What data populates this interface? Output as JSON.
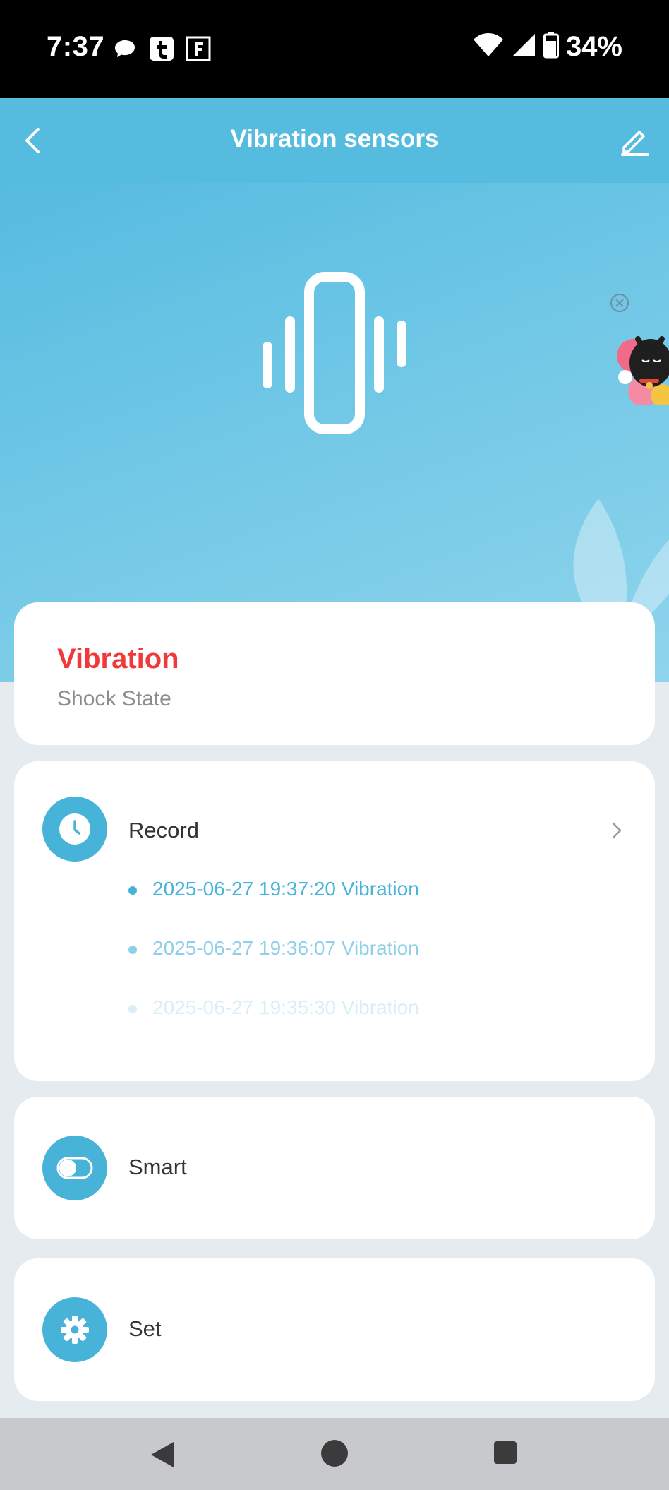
{
  "status_bar": {
    "time": "7:37",
    "battery_text": "34%",
    "left_icons": [
      "chat-bubble-icon",
      "t-app-icon",
      "f-app-icon"
    ],
    "right_icons": [
      "wifi-icon",
      "cell-signal-icon",
      "battery-icon"
    ]
  },
  "header": {
    "title": "Vibration sensors",
    "back_icon": "chevron-left-icon",
    "edit_icon": "pencil-icon"
  },
  "hero": {
    "device_icon": "vibration-icon",
    "ad_icons": [
      "close-circle-icon",
      "lucky-cat-sticker"
    ]
  },
  "status_card": {
    "value": "Vibration",
    "label": "Shock State"
  },
  "record_card": {
    "label": "Record",
    "icon": "clock-icon",
    "items": [
      "2025-06-27 19:37:20 Vibration",
      "2025-06-27 19:36:07 Vibration",
      "2025-06-27 19:35:30 Vibration"
    ]
  },
  "smart_card": {
    "label": "Smart",
    "icon": "toggle-icon"
  },
  "set_card": {
    "label": "Set",
    "icon": "gear-icon"
  },
  "colors": {
    "accent": "#47b3d9",
    "header": "#56bcdf",
    "alert": "#f03a3a"
  },
  "nav_bar": {
    "icons": [
      "nav-back-icon",
      "nav-home-icon",
      "nav-recents-icon"
    ]
  }
}
